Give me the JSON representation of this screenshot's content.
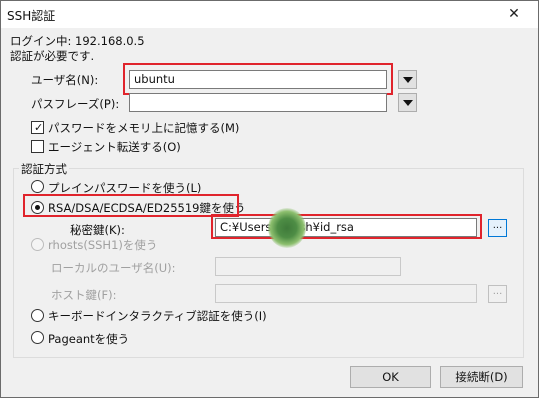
{
  "window": {
    "title": "SSH認証",
    "close_glyph": "✕"
  },
  "login_status": "ログイン中: 192.168.0.5",
  "auth_required": "認証が必要です.",
  "username": {
    "label": "ユーザ名(N):",
    "value": "ubuntu"
  },
  "passphrase": {
    "label": "パスフレーズ(P):",
    "value": ""
  },
  "remember_password": {
    "label": "パスワードをメモリ上に記憶する(M)",
    "checked": true,
    "check_glyph": "✓"
  },
  "agent_forward": {
    "label": "エージェント転送する(O)",
    "checked": false
  },
  "auth_method": {
    "group_label": "認証方式",
    "plain_password": {
      "label": "プレインパスワードを使う(L)",
      "selected": false
    },
    "rsa": {
      "label": "RSA/DSA/ECDSA/ED25519鍵を使う",
      "selected": true
    },
    "private_key": {
      "label": "秘密鍵(K):",
      "value": "C:¥Users¥         ¥.ssh¥id_rsa",
      "browse": "..."
    },
    "rhosts": {
      "label": "rhosts(SSH1)を使う",
      "selected": false,
      "enabled": false
    },
    "local_user": {
      "label": "ローカルのユーザ名(U):",
      "value": ""
    },
    "host_key": {
      "label": "ホスト鍵(F):",
      "value": "",
      "browse": "..."
    },
    "keyboard_interactive": {
      "label": "キーボードインタラクティブ認証を使う(I)",
      "selected": false
    },
    "pageant": {
      "label": "Pageantを使う",
      "selected": false
    }
  },
  "buttons": {
    "ok": "OK",
    "disconnect": "接続断(D)"
  },
  "colors": {
    "highlight": "#e0242c",
    "dialog_bg": "#f0f0f0",
    "focus_border": "#0078d7"
  }
}
